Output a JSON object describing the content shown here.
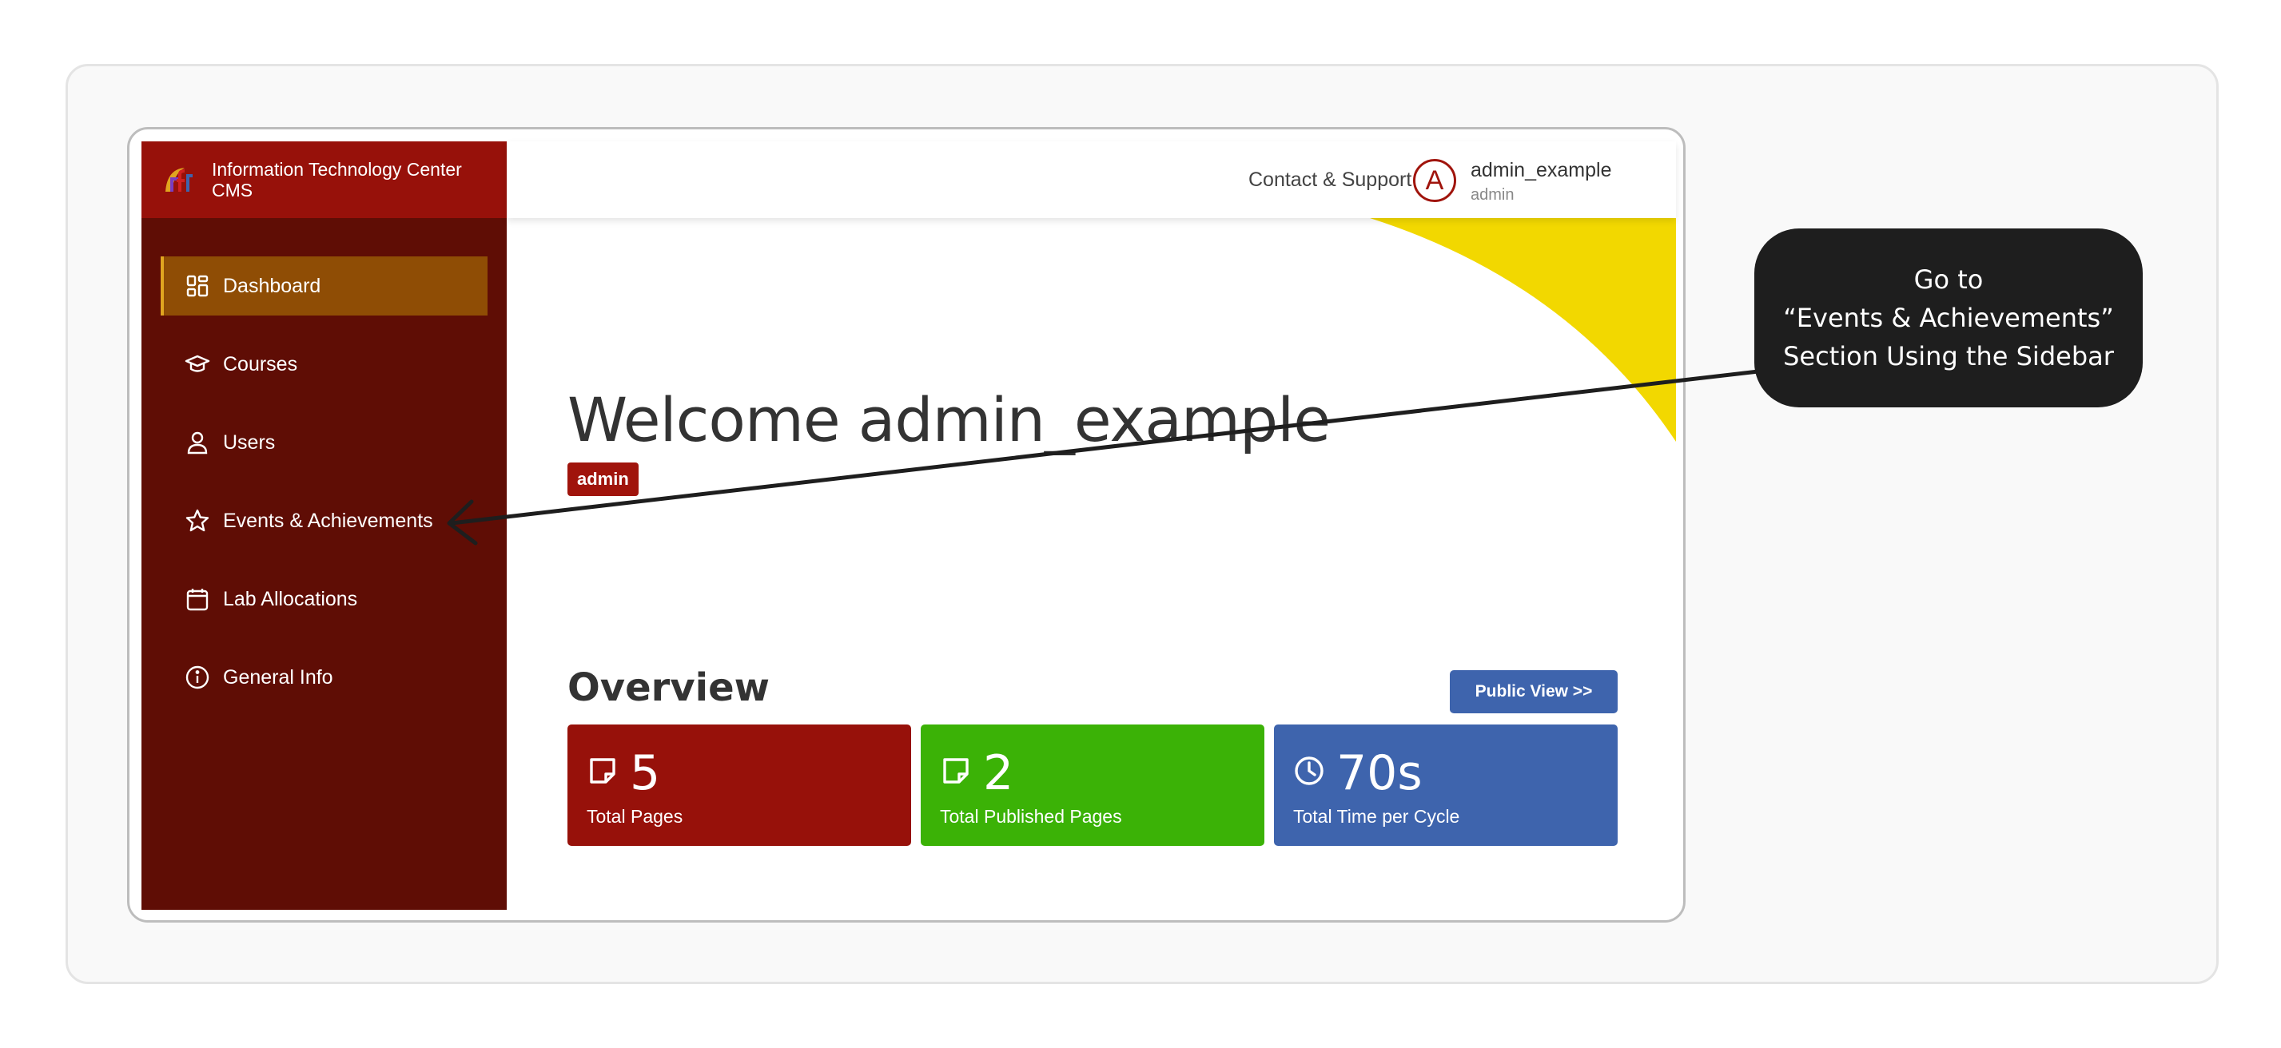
{
  "app": {
    "brand_name": "Information Technology Center CMS"
  },
  "sidebar": {
    "items": [
      {
        "label": "Dashboard",
        "icon": "dashboard-grid-icon",
        "active": true
      },
      {
        "label": "Courses",
        "icon": "graduation-cap-icon",
        "active": false
      },
      {
        "label": "Users",
        "icon": "user-icon",
        "active": false
      },
      {
        "label": "Events & Achievements",
        "icon": "star-icon",
        "active": false
      },
      {
        "label": "Lab Allocations",
        "icon": "calendar-icon",
        "active": false
      },
      {
        "label": "General Info",
        "icon": "info-circle-icon",
        "active": false
      }
    ]
  },
  "header": {
    "contact_label": "Contact & Support",
    "avatar_letter": "A",
    "user_name": "admin_example",
    "user_role": "admin"
  },
  "main": {
    "welcome": "Welcome admin_example",
    "role_badge": "admin",
    "overview_title": "Overview",
    "public_view_label": "Public View  >>",
    "stats": [
      {
        "value": "5",
        "label": "Total Pages",
        "icon": "note-icon",
        "color": "#97110a"
      },
      {
        "value": "2",
        "label": "Total Published Pages",
        "icon": "note-icon",
        "color": "#3bb206"
      },
      {
        "value": "70s",
        "label": "Total Time per Cycle",
        "icon": "clock-icon",
        "color": "#3e64ad"
      }
    ]
  },
  "callout": {
    "line1": "Go to",
    "line2": "“Events & Achievements”",
    "line3": "Section Using the Sidebar"
  },
  "colors": {
    "sidebar_bg": "#5f0d05",
    "brand_bg": "#97110a",
    "active_item_bg": "#8f4d05",
    "accent_yellow": "#f2d800",
    "primary_blue": "#3e64ad"
  }
}
